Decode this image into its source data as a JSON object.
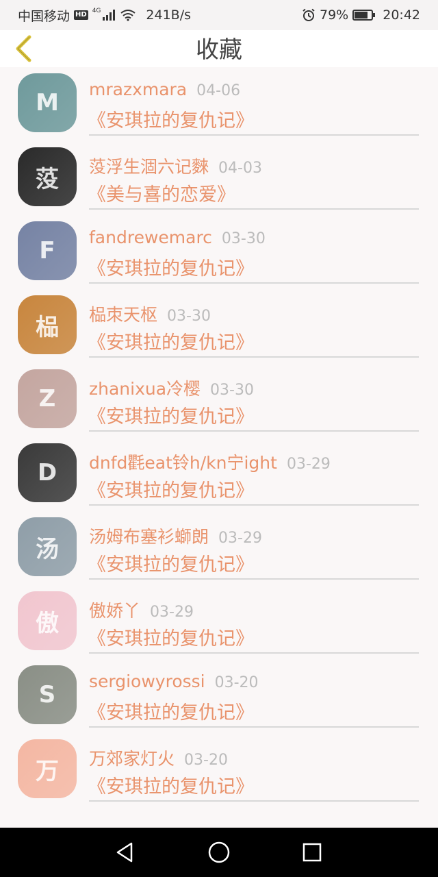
{
  "status_bar": {
    "carrier": "中国移动",
    "hd": "HD",
    "network": "4G",
    "speed": "241B/s",
    "battery_percent": "79%",
    "battery_level": 0.79,
    "time": "20:42"
  },
  "header": {
    "title": "收藏",
    "back_icon": "chevron-left-icon"
  },
  "colors": {
    "accent": "#e9936c",
    "back_icon": "#d9c23c",
    "date": "#bbbbbb"
  },
  "items": [
    {
      "name": "mrazxmara",
      "date": "04-06",
      "title": "《安琪拉的复仇记》",
      "avatar_color": "#6f9a9c",
      "avatar_initial": "M"
    },
    {
      "name": "莈浮生涸六记麳",
      "date": "04-03",
      "title": "《美与喜的恋爱》",
      "avatar_color": "#2a2a2a",
      "avatar_initial": "莈"
    },
    {
      "name": "fandrewemarc",
      "date": "03-30",
      "title": "《安琪拉的复仇记》",
      "avatar_color": "#7683a4",
      "avatar_initial": "F"
    },
    {
      "name": "榀朿天枢",
      "date": "03-30",
      "title": "《安琪拉的复仇记》",
      "avatar_color": "#c8863e",
      "avatar_initial": "榀"
    },
    {
      "name": "zhanixua冷樱",
      "date": "03-30",
      "title": "《安琪拉的复仇记》",
      "avatar_color": "#c4a6a0",
      "avatar_initial": "Z"
    },
    {
      "name": "dnfd氍eat铃h/kn宁ight",
      "date": "03-29",
      "title": "《安琪拉的复仇记》",
      "avatar_color": "#3a3a3a",
      "avatar_initial": "D"
    },
    {
      "name": "汤姆布塞衫螄朗",
      "date": "03-29",
      "title": "《安琪拉的复仇记》",
      "avatar_color": "#8f9ea8",
      "avatar_initial": "汤"
    },
    {
      "name": "傲娇丫",
      "date": "03-29",
      "title": "《安琪拉的复仇记》",
      "avatar_color": "#f1c6cf",
      "avatar_initial": "傲"
    },
    {
      "name": "sergiowyrossi",
      "date": "03-20",
      "title": "《安琪拉的复仇记》",
      "avatar_color": "#8a8f86",
      "avatar_initial": "S"
    },
    {
      "name": "万郊家灯火",
      "date": "03-20",
      "title": "《安琪拉的复仇记》",
      "avatar_color": "#f4b7a3",
      "avatar_initial": "万"
    }
  ],
  "nav_bar": {
    "back": "triangle-back-icon",
    "home": "circle-home-icon",
    "recents": "square-recents-icon"
  }
}
